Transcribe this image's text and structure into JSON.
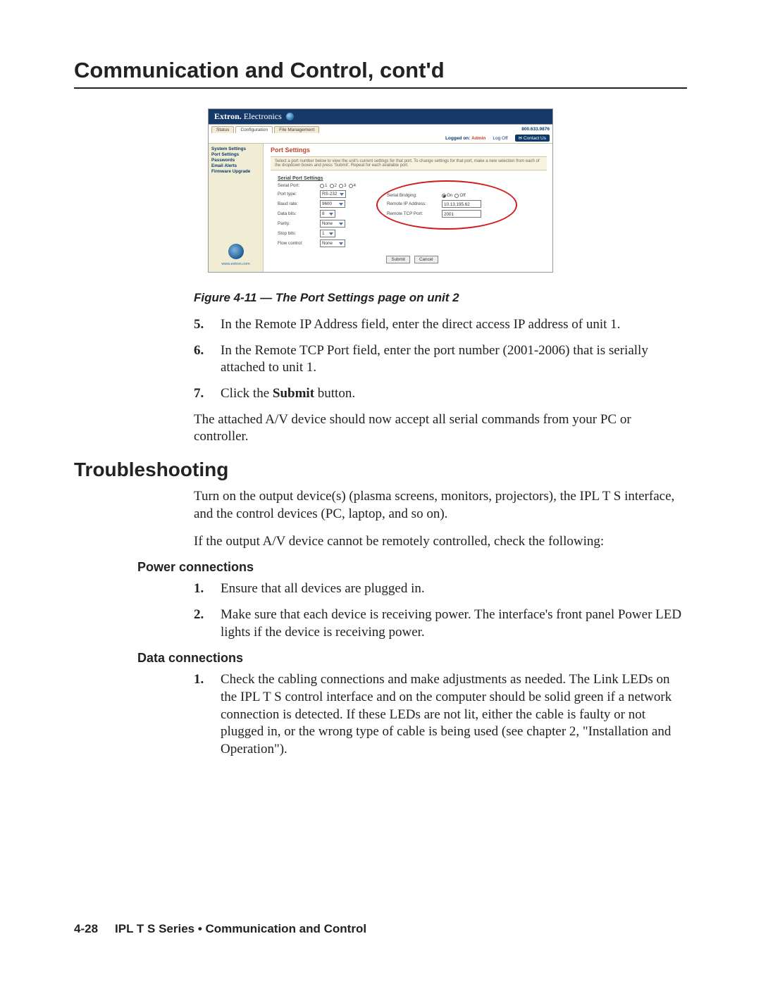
{
  "page_title": "Communication and Control, cont'd",
  "screenshot": {
    "brand": "Extron.",
    "brand2": "Electronics",
    "tabs": [
      "Status",
      "Configuration",
      "File Management"
    ],
    "phone": "800.633.9876",
    "logged_on_label": "Logged on:",
    "logged_on_value": "Admin",
    "log_off": "Log Off",
    "contact_us": "Contact Us",
    "sidebar_links": [
      "System Settings",
      "Port Settings",
      "Passwords",
      "Email Alerts",
      "Firmware Upgrade"
    ],
    "sidebar_url": "www.extron.com",
    "main_heading": "Port Settings",
    "description": "Select a port number below to view the unit's current settings for that port. To change settings for that port, make a new selection from each of the dropdown boxes and press 'Submit'. Repeat for each available port.",
    "settings_title": "Serial Port Settings",
    "left_rows": {
      "serial_port": {
        "label": "Serial Port:",
        "options": [
          "1",
          "2",
          "3",
          "4"
        ]
      },
      "port_type": {
        "label": "Port type:",
        "value": "RS-232"
      },
      "baud_rate": {
        "label": "Baud rate:",
        "value": "9600"
      },
      "data_bits": {
        "label": "Data bits:",
        "value": "8"
      },
      "parity": {
        "label": "Parity:",
        "value": "None"
      },
      "stop_bits": {
        "label": "Stop bits:",
        "value": "1"
      },
      "flow_ctrl": {
        "label": "Flow control:",
        "value": "None"
      }
    },
    "right_rows": {
      "serial_bridging": {
        "label": "Serial Bridging:",
        "on": "On",
        "off": "Off"
      },
      "remote_ip": {
        "label": "Remote IP Address:",
        "value": "10.13.195.62"
      },
      "remote_tcp": {
        "label": "Remote TCP Port:",
        "value": "2001"
      }
    },
    "buttons": {
      "submit": "Submit",
      "cancel": "Cancel"
    }
  },
  "figure_caption": "Figure 4-11 — The Port Settings page on unit 2",
  "steps_a": [
    {
      "num": "5.",
      "text": "In the Remote IP Address field, enter the direct access IP address of unit 1."
    },
    {
      "num": "6.",
      "text": "In the Remote TCP Port field, enter the port number (2001-2006) that is serially attached to unit 1."
    },
    {
      "num": "7.",
      "text_prefix": "Click the ",
      "bold": "Submit",
      "text_suffix": " button."
    }
  ],
  "para_after_steps": "The attached A/V device should now accept all serial commands from your PC or controller.",
  "troubleshooting_heading": "Troubleshooting",
  "troubleshooting_p1": "Turn on the output device(s) (plasma screens, monitors, projectors), the IPL T S interface, and the control devices (PC, laptop, and so on).",
  "troubleshooting_p2": "If the output A/V device cannot be remotely controlled, check the following:",
  "power_heading": "Power connections",
  "power_list": [
    {
      "num": "1.",
      "text": "Ensure that all devices are plugged in."
    },
    {
      "num": "2.",
      "text": "Make sure that each device is receiving power.  The interface's front panel Power LED lights if the device is receiving power."
    }
  ],
  "data_heading": "Data connections",
  "data_list": [
    {
      "num": "1.",
      "text": "Check the cabling connections and make adjustments as needed.  The Link LEDs on the IPL T S control interface and on the computer should be solid green if a network connection is detected.  If these LEDs are not lit, either the cable is faulty or not plugged in, or the wrong type of cable is being used (see chapter 2, \"Installation and Operation\")."
    }
  ],
  "footer": {
    "page_num": "4-28",
    "text": "IPL T S Series • Communication and Control"
  }
}
